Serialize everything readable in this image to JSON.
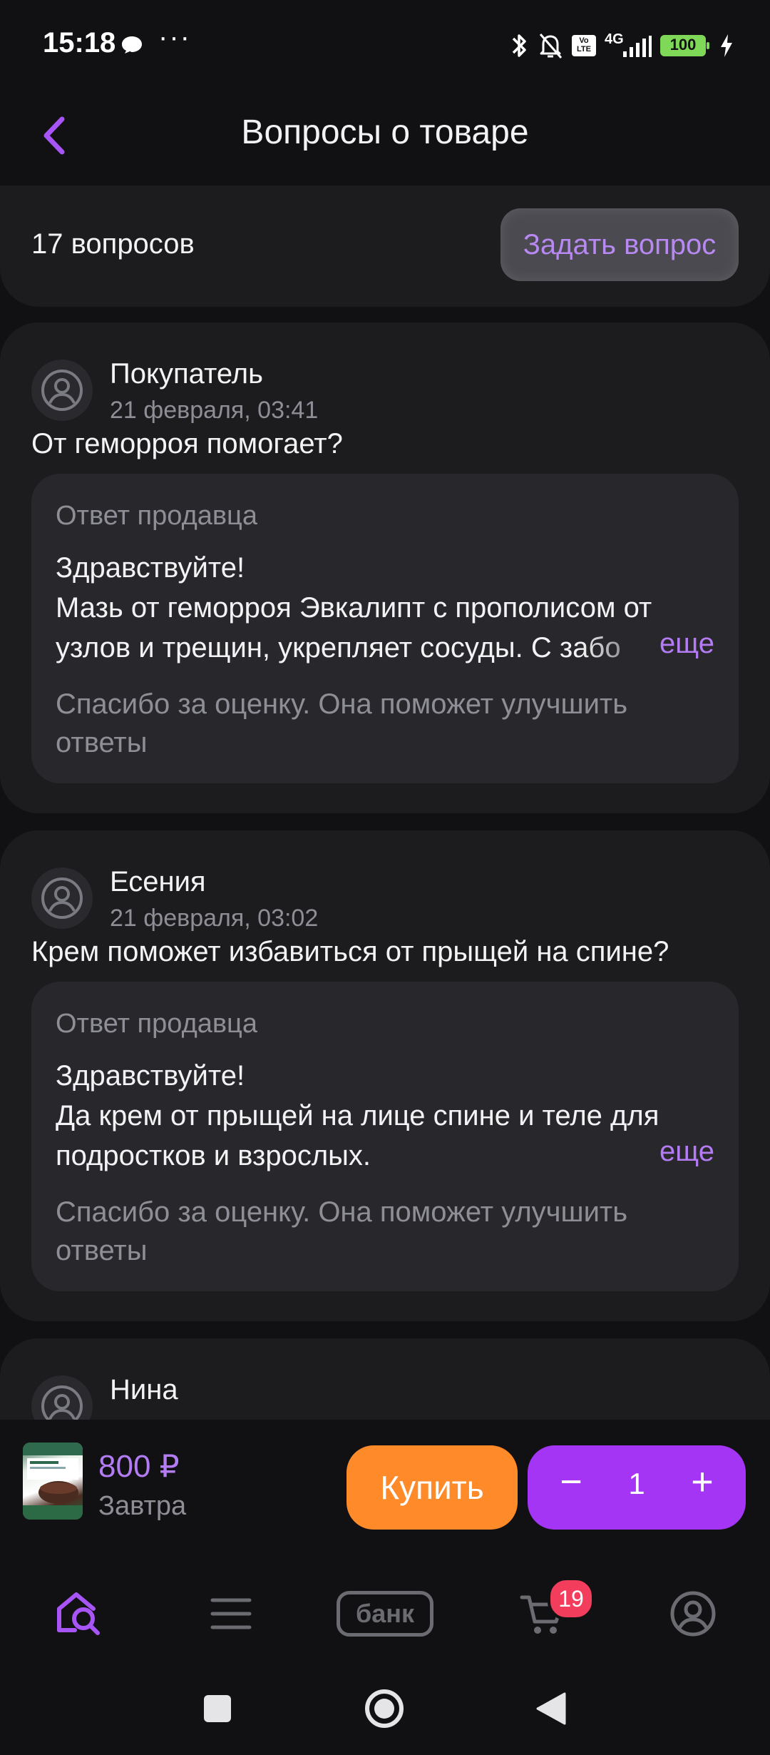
{
  "status_bar": {
    "time": "15:18",
    "dots": "···",
    "battery": "100",
    "network": "4G",
    "volte": "Vo LTE"
  },
  "header": {
    "title": "Вопросы о товаре"
  },
  "summary": {
    "count_label": "17 вопросов",
    "ask_button": "Задать вопрос"
  },
  "questions": [
    {
      "author": "Покупатель",
      "date": "21 февраля, 03:41",
      "text": "От геморроя помогает?",
      "answer": {
        "label": "Ответ продавца",
        "text": "Здравствуйте!\nМазь от геморроя Эвкалипт с прополисом от узлов и трещин, укрепляет сосуды. С забо",
        "more": "еще",
        "footer": "Спасибо за оценку. Она поможет улучшить ответы"
      }
    },
    {
      "author": "Есения",
      "date": "21 февраля, 03:02",
      "text": "Крем поможет избавиться от прыщей на спине?",
      "answer": {
        "label": "Ответ продавца",
        "text": "Здравствуйте!\nДа крем от прыщей на лице спине и теле для подростков и взрослых.",
        "more": "еще",
        "footer": "Спасибо за оценку. Она поможет улучшить ответы"
      }
    },
    {
      "author": "Нина"
    }
  ],
  "buy_bar": {
    "price": "800 ₽",
    "delivery": "Завтра",
    "buy_button": "Купить",
    "quantity": "1",
    "minus": "−",
    "plus": "+"
  },
  "bottom_nav": {
    "bank_label": "банк",
    "cart_count": "19",
    "active_color": "#a855f7",
    "inactive_color": "#6b6b72"
  },
  "colors": {
    "accent": "#b37cf4",
    "buy": "#ff8a2a",
    "qty": "#a535f5",
    "badge": "#f23d5c"
  }
}
